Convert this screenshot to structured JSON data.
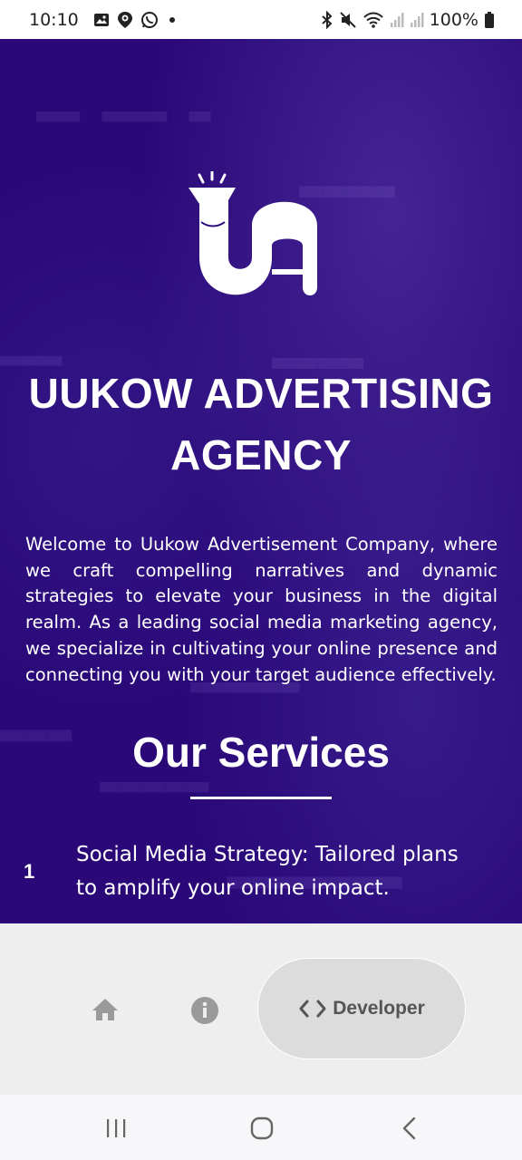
{
  "status_bar": {
    "time": "10:10",
    "battery": "100%",
    "left_icons": [
      "image-icon",
      "location-pin-icon",
      "whatsapp-icon",
      "dot-icon"
    ],
    "right_icons": [
      "bluetooth-icon",
      "mute-icon",
      "wifi-icon",
      "signal-icon",
      "signal-icon",
      "battery-icon"
    ]
  },
  "hero": {
    "title": "UUKOW ADVERTISING AGENCY",
    "intro": "Welcome to Uukow Advertisement Company, where we craft compelling narratives and dynamic strategies to elevate your business in the digital realm. As a leading social media marketing agency, we specialize in cultivating your online presence and connecting you with your target audience effectively.",
    "services_heading": "Our Services",
    "services": [
      {
        "number": "1",
        "text": "Social Media Strategy: Tailored plans to amplify your online impact."
      }
    ],
    "background_color": "#2a0878"
  },
  "bottom_nav": {
    "home_icon": "home-icon",
    "info_icon": "info-icon",
    "developer_icon": "code-icon",
    "developer_label": "Developer"
  },
  "system_nav": {
    "recent_icon": "recent-apps-icon",
    "home_icon": "home-circle-icon",
    "back_icon": "back-icon"
  }
}
